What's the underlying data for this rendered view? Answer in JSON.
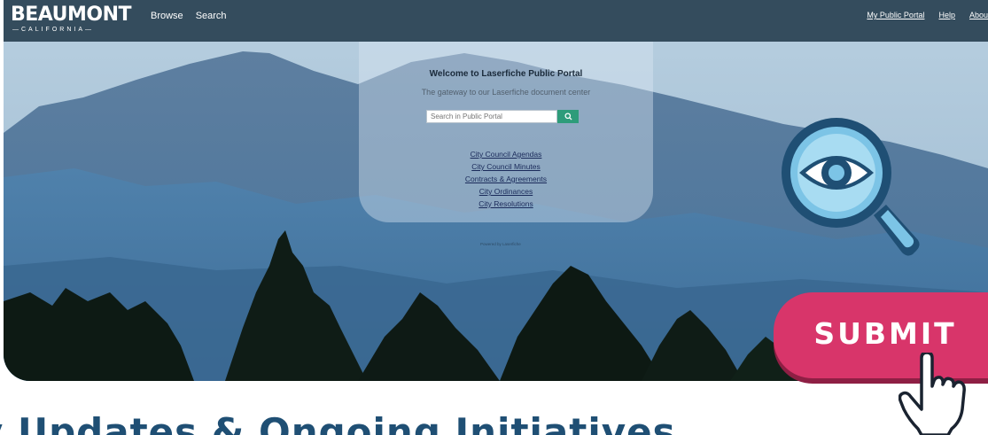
{
  "header": {
    "logo_main": "BEAUMONT",
    "logo_sub": "—CALIFORNIA—",
    "nav": [
      "Browse",
      "Search"
    ],
    "right_links": [
      "My Public Portal",
      "Help",
      "Abou"
    ]
  },
  "panel": {
    "welcome": "Welcome to Laserfiche Public Portal",
    "gateway": "The gateway to our Laserfiche document center",
    "search_placeholder": "Search in Public Portal",
    "links": [
      "City Council Agendas",
      "City Council Minutes",
      "Contracts & Agreements",
      "City Ordinances",
      "City Resolutions"
    ],
    "powered_by": "Powered by Laserfiche"
  },
  "overlay": {
    "submit_label": "SUBMIT",
    "magnifier_icon": "eye-magnifier-icon",
    "hand_icon": "pointer-hand-icon"
  },
  "headline": "y Updates & Ongoing Initiatives",
  "colors": {
    "topbar": "#344c5d",
    "search_button": "#2e9c7a",
    "submit_button": "#d8356a",
    "headline": "#1f4f74",
    "magnifier": "#1f4f74"
  }
}
